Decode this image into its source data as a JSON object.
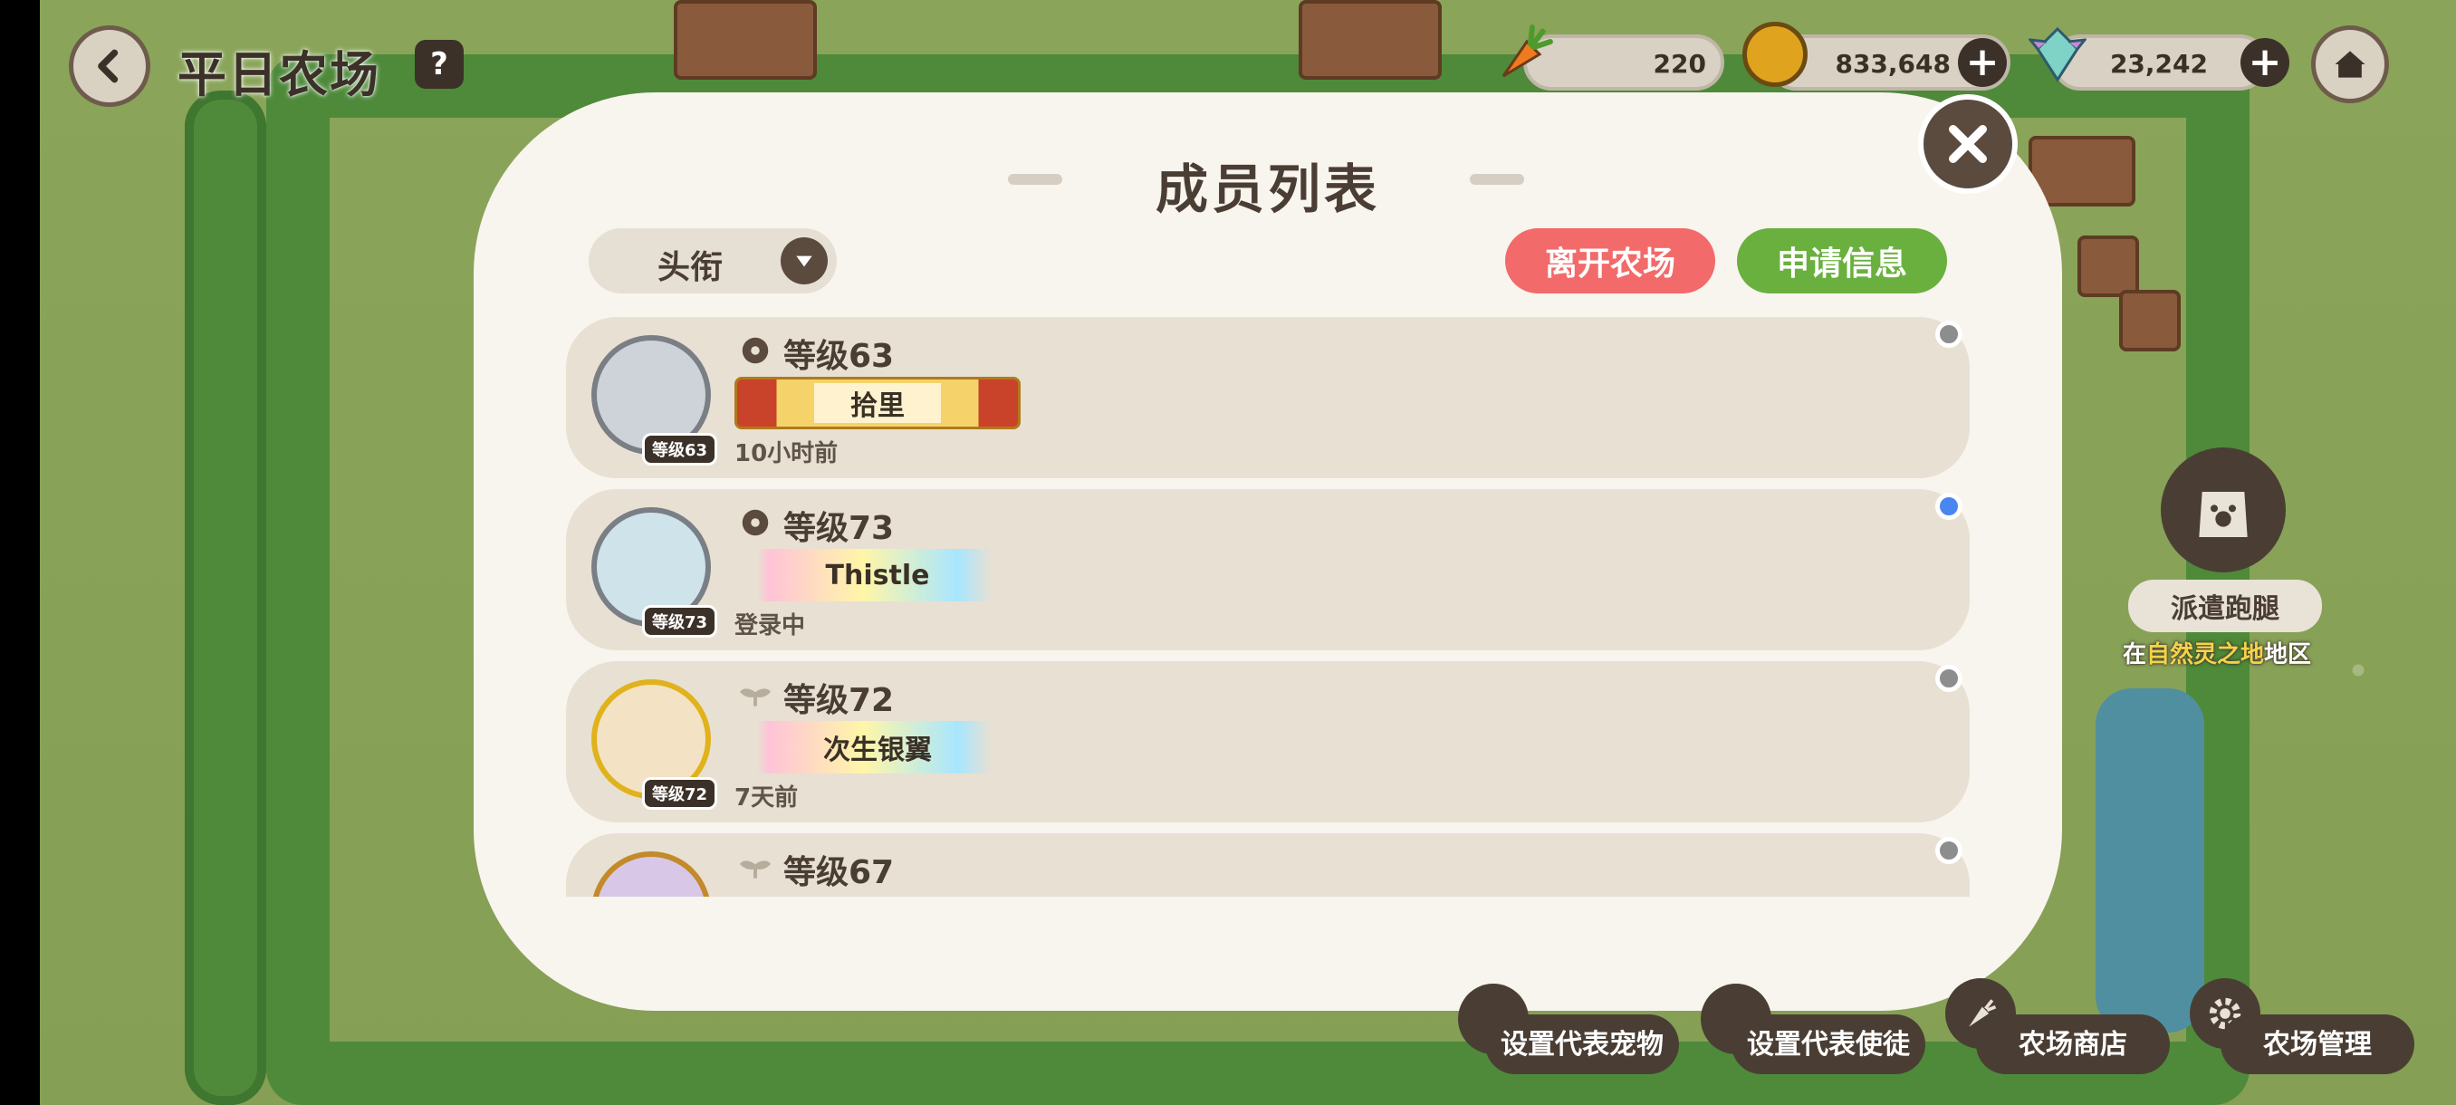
{
  "header": {
    "title": "平日农场",
    "resources": [
      {
        "icon": "carrot-icon",
        "value": "220"
      },
      {
        "icon": "gold-coin-icon",
        "value": "833,648"
      },
      {
        "icon": "crystal-icon",
        "value": "23,242"
      }
    ]
  },
  "modal": {
    "title": "成员列表",
    "sort_label": "头衔",
    "leave_label": "离开农场",
    "apply_label": "申请信息",
    "members": [
      {
        "level": "等级63",
        "badge": "等级63",
        "name": "拾里",
        "status": "10小时前",
        "online": false
      },
      {
        "level": "等级73",
        "badge": "等级73",
        "name": "Thistle",
        "status": "登录中",
        "online": true
      },
      {
        "level": "等级72",
        "badge": "等级72",
        "name": "次生银翼",
        "status": "7天前",
        "online": false
      },
      {
        "level": "等级67",
        "badge": "",
        "name": "",
        "status": "",
        "online": false
      }
    ]
  },
  "dispatch": {
    "label": "派遣跑腿",
    "sub_prefix": "在",
    "sub_highlight": "自然灵之地",
    "sub_suffix": "地区"
  },
  "bottom": {
    "pet_label": "设置代表宠物",
    "envoy_label": "设置代表使徒",
    "shop_label": "农场商店",
    "manage_label": "农场管理"
  },
  "colors": {
    "leave": "#f26a6a",
    "apply": "#6ab03e",
    "online_dot": "#4a86f0",
    "offline_dot": "#8d8d8d"
  }
}
